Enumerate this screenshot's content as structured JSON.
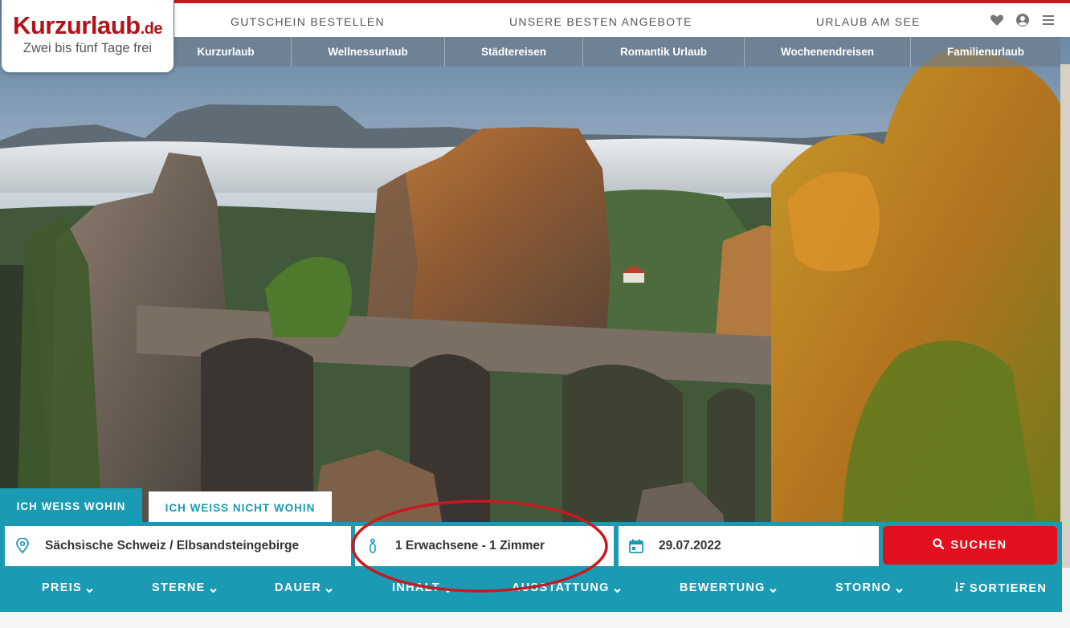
{
  "logo": {
    "brand": "Kurzurlaub",
    "tld": ".de",
    "tagline": "Zwei bis fünf Tage frei"
  },
  "top_nav": {
    "links": [
      "GUTSCHEIN BESTELLEN",
      "UNSERE BESTEN ANGEBOTE",
      "URLAUB AM SEE"
    ],
    "icons": [
      "heart-icon",
      "user-icon",
      "menu-icon"
    ]
  },
  "categories": [
    "Kurzurlaub",
    "Wellnessurlaub",
    "Städtereisen",
    "Romantik Urlaub",
    "Wochenendreisen",
    "Familienurlaub"
  ],
  "search": {
    "tabs": {
      "active": "ICH WEISS WOHIN",
      "inactive": "ICH WEISS NICHT WOHIN"
    },
    "destination": "Sächsische Schweiz / Elbsandsteingebirge",
    "guests": "1 Erwachsene - 1 Zimmer",
    "date": "29.07.2022",
    "button": "SUCHEN"
  },
  "filters": [
    "PREIS",
    "STERNE",
    "DAUER",
    "INHALT",
    "AUSSTATTUNG",
    "BEWERTUNG",
    "STORNO"
  ],
  "sort_label": "SORTIEREN",
  "colors": {
    "brand_red": "#c8171f",
    "teal": "#1a9bb3",
    "search_red": "#e2101f",
    "annotation_red": "#c8191f"
  }
}
